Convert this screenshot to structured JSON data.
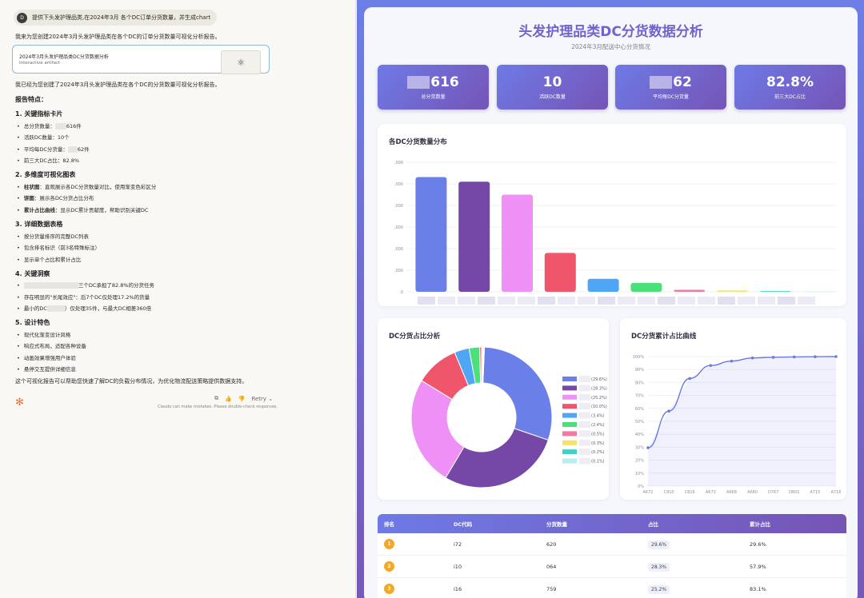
{
  "chat": {
    "user_avatar": "D",
    "user_message": "提供下头发护理品类,在2024年3月 各个DC订单分货数量，并生成chart",
    "ai_intro": "我来为您创建2024年3月头发护理品类在各个DC的订单分货数量可视化分析报告。",
    "artifact_title": "2024年3月头发护理品类DC分货数据分析",
    "artifact_type": "Interactive artifact",
    "ai_done": "我已经为您创建了2024年3月头发护理品类在各个DC的分货数量可视化分析报告。",
    "report_heading": "报告特点：",
    "sections": [
      {
        "heading": "1. 关键指标卡片",
        "items": [
          "总分货数量：",
          "616件",
          "活跃DC数量：10个",
          "平均每DC分货量：",
          "62件",
          "前三大DC占比：82.8%"
        ]
      },
      {
        "heading": "2. 多维度可视化图表"
      },
      {
        "heading": "3. 详细数据表格"
      },
      {
        "heading": "4. 关键洞察"
      },
      {
        "heading": "5. 设计特色"
      }
    ],
    "s1": {
      "total_prefix": "总分货数量：",
      "total_suffix": "616件",
      "active": "活跃DC数量：10个",
      "avg_prefix": "平均每DC分货量：",
      "avg_suffix": "62件",
      "top3": "前三大DC占比：82.8%"
    },
    "s2": {
      "bar_bold": "柱状图",
      "bar_text": "：直观展示各DC分货数量对比，使用渐变色彩区分",
      "pie_bold": "饼图",
      "pie_text": "：展示各DC分货占比分布",
      "cum_bold": "累计占比曲线",
      "cum_text": "：显示DC累计贡献度，帮助识别关键DC"
    },
    "s3": [
      "按分货量排序的完整DC列表",
      "包含排名标识（前3名特殊标注）",
      "显示单个占比和累计占比"
    ],
    "s4": {
      "i1_suffix": "三个DC承担了82.8%的分货任务",
      "i2": "存在明显的\"长尾效应\"：后7个DC仅处理17.2%的货量",
      "i3_prefix": "最小的DC",
      "i3_suffix": "）仅处理35件，与最大DC相差360倍"
    },
    "s5": [
      "现代化渐变设计风格",
      "响应式布局，适配各种设备",
      "动画效果增强用户体验",
      "悬停交互提供详细信息"
    ],
    "closing": "这个可视化报告可以帮助您快速了解DC的负载分布情况，为优化物流配送策略提供数据支持。",
    "retry_label": "Retry",
    "disclaimer": "Claude can make mistakes. Please double-check responses."
  },
  "report": {
    "title": "头发护理品类DC分货数据分析",
    "subtitle": "2024年3月配送中心分货情况",
    "kpis": [
      {
        "value_visible": "616",
        "masked": true,
        "label": "总分货数量"
      },
      {
        "value_visible": "10",
        "masked": false,
        "label": "活跃DC数量"
      },
      {
        "value_visible": "62",
        "masked": true,
        "label": "平均每DC分货量"
      },
      {
        "value_visible": "82.8%",
        "masked": false,
        "label": "前三大DC占比"
      }
    ],
    "bar_title": "各DC分货数量分布",
    "pie_title": "DC分货占比分析",
    "cum_title": "DC分货累计占比曲线",
    "table": {
      "headers": [
        "排名",
        "DC代码",
        "分货数量",
        "占比",
        "累计占比"
      ],
      "rows": [
        {
          "rank": "1",
          "code": "i72",
          "qty": "620",
          "pct": "29.6%",
          "cum": "29.6%"
        },
        {
          "rank": "2",
          "code": "i10",
          "qty": "064",
          "pct": "28.3%",
          "cum": "57.9%"
        },
        {
          "rank": "3",
          "code": "i16",
          "qty": "759",
          "pct": "25.2%",
          "cum": "83.1%"
        }
      ]
    }
  },
  "chart_data": [
    {
      "type": "bar",
      "title": "各DC分货数量分布",
      "y_ticks": [
        ",000",
        ",000",
        ",000",
        ",000",
        ",000",
        ",000",
        "0"
      ],
      "ylim": [
        0,
        7000
      ],
      "values": [
        6200,
        5950,
        5250,
        2100,
        700,
        480,
        110,
        70,
        40,
        20
      ],
      "colors": [
        "#6b7fe8",
        "#7548a8",
        "#ee90f5",
        "#f0566b",
        "#4ea6f5",
        "#4be07a",
        "#f27aa2",
        "#f8e16a",
        "#3fd2c8",
        "#b9ecec"
      ]
    },
    {
      "type": "pie",
      "title": "DC分货占比分析",
      "values": [
        29.6,
        28.3,
        25.2,
        10.0,
        3.4,
        2.4,
        0.5,
        0.3,
        0.2,
        0.1
      ],
      "legend_labels": [
        "(29.6%)",
        "(28.3%)",
        "(25.2%)",
        "(10.0%)",
        "(3.4%)",
        "(2.4%)",
        "(0.5%)",
        "(0.3%)",
        "(0.2%)",
        "(0.1%)"
      ],
      "colors": [
        "#6b7fe8",
        "#7548a8",
        "#ee90f5",
        "#f0566b",
        "#4ea6f5",
        "#4be07a",
        "#f27aa2",
        "#f8e16a",
        "#3fd2c8",
        "#b9ecec"
      ]
    },
    {
      "type": "line",
      "title": "DC分货累计占比曲线",
      "x": [
        "A672",
        "C810",
        "C816",
        "A673",
        "A668",
        "A680",
        "D767",
        "D801",
        "A715",
        "A716"
      ],
      "values": [
        29.6,
        57.9,
        83.1,
        93.1,
        96.5,
        98.9,
        99.4,
        99.7,
        99.9,
        100
      ],
      "ylim": [
        0,
        100
      ],
      "y_ticks": [
        "100%",
        "90%",
        "80%",
        "70%",
        "60%",
        "50%",
        "40%",
        "30%",
        "20%",
        "10%",
        "0%"
      ],
      "color": "#6a7ae0"
    }
  ]
}
